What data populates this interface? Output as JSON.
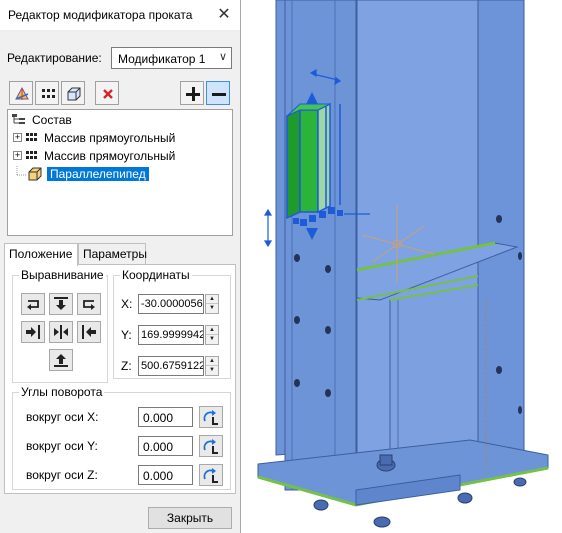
{
  "dialog": {
    "title": "Редактор модификатора проката",
    "close_glyph": "✕",
    "edit_label": "Редактирование:",
    "edit_value": "Модификатор 1",
    "toolbar_icons": [
      "shape-icon",
      "array-icon",
      "box-icon",
      "delete-icon",
      "plus-icon",
      "minus-icon"
    ],
    "tree": {
      "root": "Состав",
      "items": [
        {
          "label": "Массив прямоугольный",
          "expander": "+"
        },
        {
          "label": "Массив прямоугольный",
          "expander": "+"
        },
        {
          "label": "Параллелепипед",
          "selected": true
        }
      ]
    },
    "tabs": [
      {
        "label": "Положение",
        "active": true
      },
      {
        "label": "Параметры",
        "active": false
      }
    ],
    "align_group": "Выравнивание",
    "coord_group": "Координаты",
    "coords": [
      {
        "axis": "X:",
        "value": "-30.0000056"
      },
      {
        "axis": "Y:",
        "value": "169.9999942"
      },
      {
        "axis": "Z:",
        "value": "500.6759122"
      }
    ],
    "rotation_group": "Углы поворота",
    "rotations": [
      {
        "label": "вокруг оси X:",
        "value": "0.000"
      },
      {
        "label": "вокруг оси Y:",
        "value": "0.000"
      },
      {
        "label": "вокруг оси Z:",
        "value": "0.000"
      }
    ],
    "close_button": "Закрыть"
  },
  "colors": {
    "steel_blue": "#6e94d8",
    "steel_blue_dark": "#4b6fb8",
    "weld_green": "#74c04a",
    "selection_green": "#1f9b2e",
    "selection_blue": "#1e5bd8",
    "accent": "#0078d7"
  }
}
